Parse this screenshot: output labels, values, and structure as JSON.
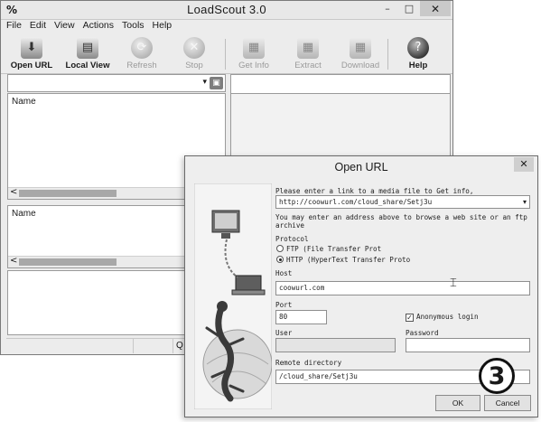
{
  "main_window": {
    "app_icon": "%",
    "title": "LoadScout 3.0",
    "controls": {
      "minimize": "–",
      "maximize": "□",
      "close": "✕"
    },
    "menu": [
      "File",
      "Edit",
      "View",
      "Actions",
      "Tools",
      "Help"
    ],
    "toolbar": [
      {
        "label": "Open URL",
        "icon": "open-url-icon",
        "glyph": "⬇",
        "enabled": true
      },
      {
        "label": "Local View",
        "icon": "local-view-icon",
        "glyph": "▤",
        "enabled": true
      },
      {
        "label": "Refresh",
        "icon": "refresh-icon",
        "glyph": "⟳",
        "enabled": false
      },
      {
        "label": "Stop",
        "icon": "stop-icon",
        "glyph": "✕",
        "enabled": false
      },
      {
        "label": "Get Info",
        "icon": "get-info-icon",
        "glyph": "▦",
        "enabled": false
      },
      {
        "label": "Extract",
        "icon": "extract-icon",
        "glyph": "▦",
        "enabled": false
      },
      {
        "label": "Download",
        "icon": "download-icon",
        "glyph": "▦",
        "enabled": false
      },
      {
        "label": "Help",
        "icon": "help-icon",
        "glyph": "?",
        "enabled": true
      }
    ],
    "left_pane": {
      "column_header": "Name",
      "scroll_arrow": "<"
    },
    "lower_pane": {
      "column_header": "Name",
      "scroll_arrow": "<"
    },
    "status_text": "Q"
  },
  "dialog": {
    "title": "Open URL",
    "close": "✕",
    "instruction": "Please enter a link to a media file to Get info,",
    "url_value": "http://coowurl.com/cloud_share/Setj3u",
    "hint_line1": "You may enter an address above to browse a web site or an ftp",
    "hint_line2": "archive",
    "protocol_label": "Protocol",
    "protocol_options": [
      {
        "label": "FTP (File Transfer Prot",
        "selected": false
      },
      {
        "label": "HTTP (HyperText Transfer Proto",
        "selected": true
      }
    ],
    "host_label": "Host",
    "host_value": "coowurl.com",
    "port_label": "Port",
    "port_value": "80",
    "anonymous_label": "Anonymous login",
    "anonymous_checked": true,
    "user_label": "User",
    "password_label": "Password",
    "remote_dir_label": "Remote directory",
    "remote_dir_value": "/cloud_share/Setj3u",
    "ok_label": "OK",
    "cancel_label": "Cancel"
  },
  "step_badge": "3"
}
